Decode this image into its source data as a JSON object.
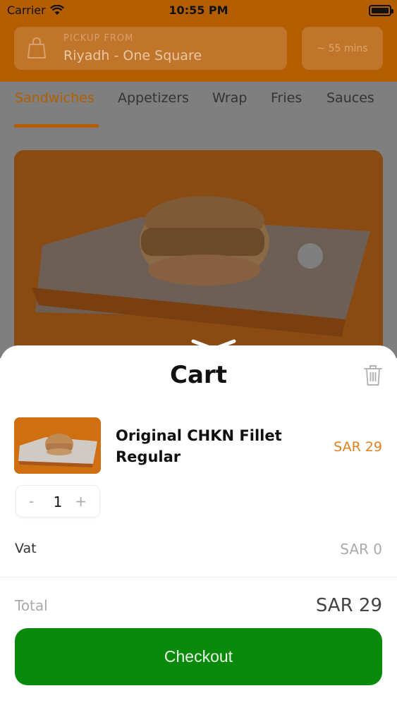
{
  "status_bar": {
    "carrier": "Carrier",
    "time": "10:55 PM",
    "icons": [
      "wifi-icon",
      "battery-icon"
    ]
  },
  "header": {
    "pickup_label": "PICKUP FROM",
    "pickup_location": "Riyadh - One Square",
    "eta": "~ 55 mins"
  },
  "tabs": {
    "items": [
      {
        "label": "Sandwiches",
        "active": true
      },
      {
        "label": "Appetizers",
        "active": false
      },
      {
        "label": "Wrap",
        "active": false
      },
      {
        "label": "Fries",
        "active": false
      },
      {
        "label": "Sauces",
        "active": false
      }
    ]
  },
  "cart": {
    "title": "Cart",
    "item": {
      "name": "Original CHKN Fillet Regular",
      "price": "SAR 29",
      "quantity": "1",
      "minus": "-",
      "plus": "+"
    },
    "vat_label": "Vat",
    "vat_value": "SAR 0",
    "total_label": "Total",
    "total_value": "SAR 29",
    "checkout_label": "Checkout"
  },
  "colors": {
    "brand": "#b35e00",
    "accent_price": "#e0801e",
    "checkout": "#0a8a0a"
  }
}
